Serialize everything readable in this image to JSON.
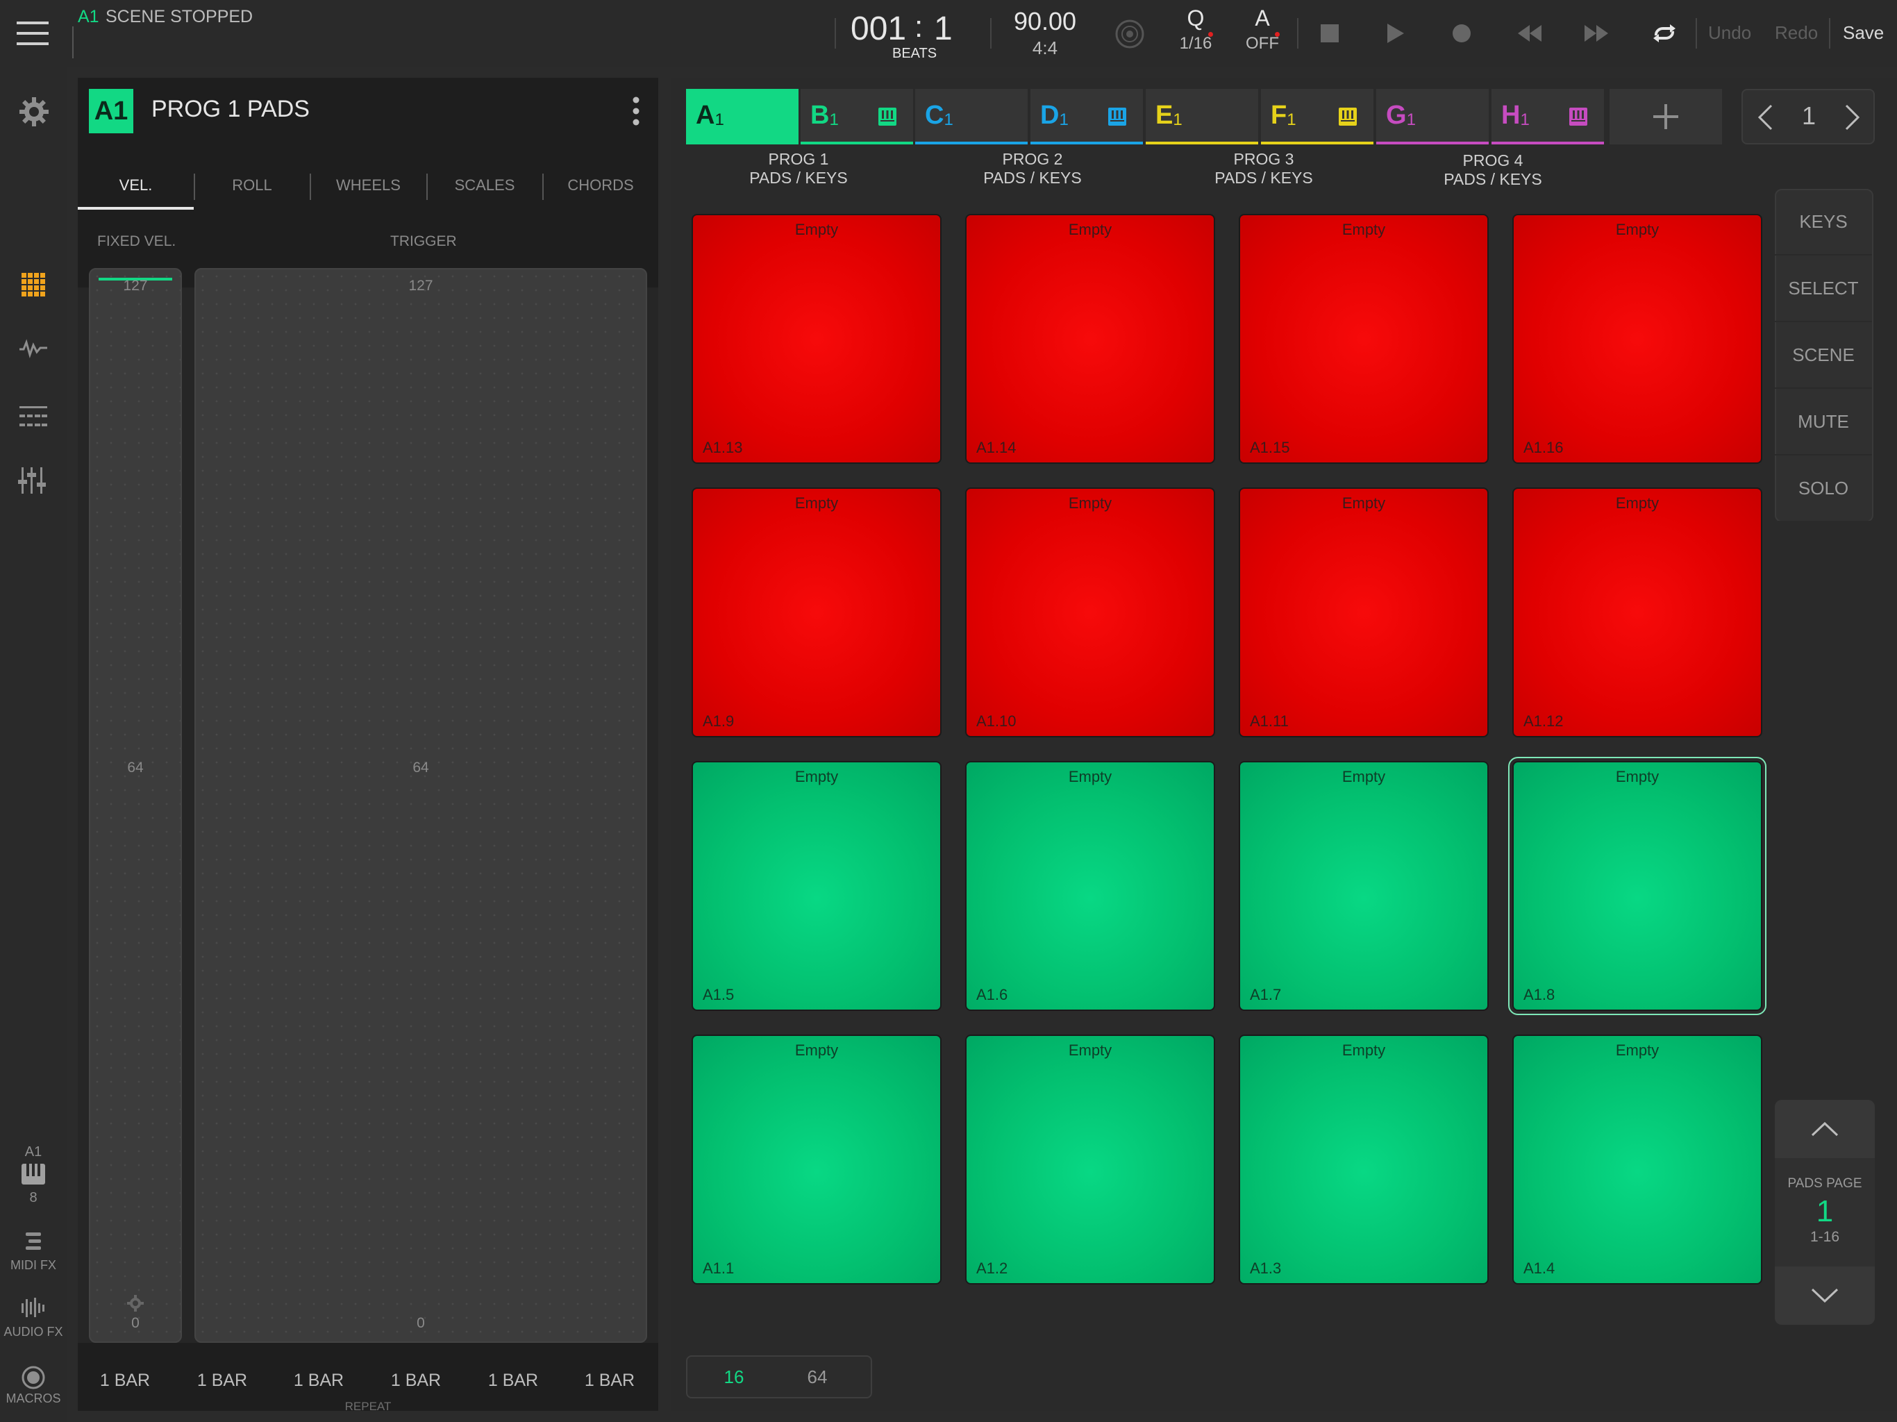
{
  "topbar": {
    "track_id": "A1",
    "scene_status": "SCENE STOPPED",
    "position_bars": "001",
    "position_sep": ":",
    "position_beats": "1",
    "position_unit": "BEATS",
    "tempo": "90.00",
    "time_signature": "4:4",
    "quantize_label": "Q",
    "quantize_value": "1/16",
    "automation_label": "A",
    "automation_value": "OFF",
    "undo_label": "Undo",
    "redo_label": "Redo",
    "save_label": "Save"
  },
  "sidebar": {
    "track_label": "A1",
    "track_number": "8",
    "midi_fx_label": "MIDI FX",
    "audio_fx_label": "AUDIO FX",
    "macros_label": "MACROS"
  },
  "panel": {
    "badge": "A1",
    "title": "PROG 1 PADS",
    "tabs": [
      "VEL.",
      "ROLL",
      "WHEELS",
      "SCALES",
      "CHORDS"
    ],
    "fixed_vel_label": "FIXED VEL.",
    "trigger_label": "TRIGGER",
    "fixed_vel_max": "127",
    "fixed_vel_mid": "64",
    "fixed_vel_min": "0",
    "trigger_max": "127",
    "trigger_mid": "64",
    "trigger_min": "0",
    "bars": [
      "1 BAR",
      "1 BAR",
      "1 BAR",
      "1 BAR",
      "1 BAR",
      "1 BAR"
    ],
    "repeat_label": "REPEAT"
  },
  "tracks": [
    {
      "letter": "A",
      "sub": "1",
      "color": "#12d884"
    },
    {
      "letter": "B",
      "sub": "1",
      "color": "#12d884"
    },
    {
      "letter": "C",
      "sub": "1",
      "color": "#1aa4e6"
    },
    {
      "letter": "D",
      "sub": "1",
      "color": "#1aa4e6"
    },
    {
      "letter": "E",
      "sub": "1",
      "color": "#e6d21a"
    },
    {
      "letter": "F",
      "sub": "1",
      "color": "#e6d21a"
    },
    {
      "letter": "G",
      "sub": "1",
      "color": "#c64cc0"
    },
    {
      "letter": "H",
      "sub": "1",
      "color": "#c64cc0"
    }
  ],
  "track_groups": [
    {
      "line1": "PROG 1",
      "line2": "PADS / KEYS"
    },
    {
      "line1": "PROG 2",
      "line2": "PADS / KEYS"
    },
    {
      "line1": "PROG 3",
      "line2": "PADS / KEYS"
    },
    {
      "line1": "PROG 4",
      "line2": "PADS / KEYS"
    }
  ],
  "page_nav": {
    "value": "1"
  },
  "pads": [
    {
      "name": "A1.13",
      "state": "Empty",
      "color": "red"
    },
    {
      "name": "A1.14",
      "state": "Empty",
      "color": "red"
    },
    {
      "name": "A1.15",
      "state": "Empty",
      "color": "red"
    },
    {
      "name": "A1.16",
      "state": "Empty",
      "color": "red"
    },
    {
      "name": "A1.9",
      "state": "Empty",
      "color": "red"
    },
    {
      "name": "A1.10",
      "state": "Empty",
      "color": "red"
    },
    {
      "name": "A1.11",
      "state": "Empty",
      "color": "red"
    },
    {
      "name": "A1.12",
      "state": "Empty",
      "color": "red"
    },
    {
      "name": "A1.5",
      "state": "Empty",
      "color": "green"
    },
    {
      "name": "A1.6",
      "state": "Empty",
      "color": "green"
    },
    {
      "name": "A1.7",
      "state": "Empty",
      "color": "green"
    },
    {
      "name": "A1.8",
      "state": "Empty",
      "color": "green",
      "selected": true
    },
    {
      "name": "A1.1",
      "state": "Empty",
      "color": "green"
    },
    {
      "name": "A1.2",
      "state": "Empty",
      "color": "green"
    },
    {
      "name": "A1.3",
      "state": "Empty",
      "color": "green"
    },
    {
      "name": "A1.4",
      "state": "Empty",
      "color": "green"
    }
  ],
  "modes": [
    "KEYS",
    "SELECT",
    "SCENE",
    "MUTE",
    "SOLO"
  ],
  "pads_page": {
    "label": "PADS PAGE",
    "value": "1",
    "range": "1-16"
  },
  "pad_count": {
    "option_a": "16",
    "option_b": "64",
    "selected": "16"
  }
}
